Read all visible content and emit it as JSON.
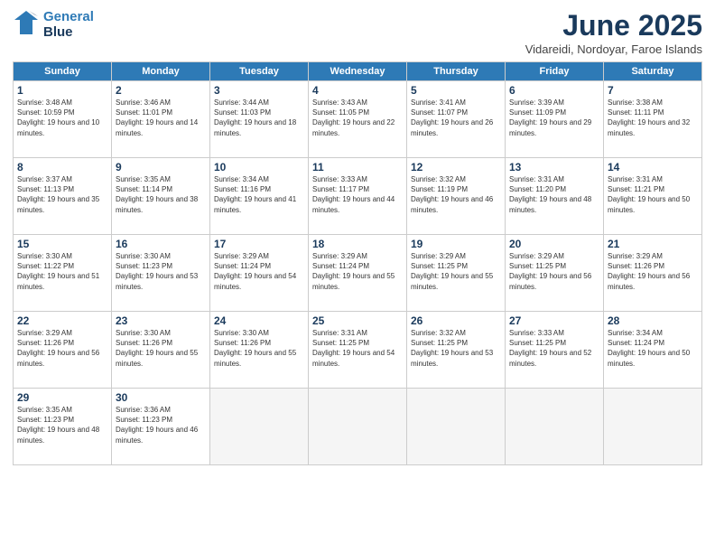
{
  "header": {
    "logo_line1": "General",
    "logo_line2": "Blue",
    "month_title": "June 2025",
    "subtitle": "Vidareidi, Nordoyar, Faroe Islands"
  },
  "weekdays": [
    "Sunday",
    "Monday",
    "Tuesday",
    "Wednesday",
    "Thursday",
    "Friday",
    "Saturday"
  ],
  "weeks": [
    [
      {
        "day": 1,
        "sunrise": "3:48 AM",
        "sunset": "10:59 PM",
        "daylight": "19 hours and 10 minutes."
      },
      {
        "day": 2,
        "sunrise": "3:46 AM",
        "sunset": "11:01 PM",
        "daylight": "19 hours and 14 minutes."
      },
      {
        "day": 3,
        "sunrise": "3:44 AM",
        "sunset": "11:03 PM",
        "daylight": "19 hours and 18 minutes."
      },
      {
        "day": 4,
        "sunrise": "3:43 AM",
        "sunset": "11:05 PM",
        "daylight": "19 hours and 22 minutes."
      },
      {
        "day": 5,
        "sunrise": "3:41 AM",
        "sunset": "11:07 PM",
        "daylight": "19 hours and 26 minutes."
      },
      {
        "day": 6,
        "sunrise": "3:39 AM",
        "sunset": "11:09 PM",
        "daylight": "19 hours and 29 minutes."
      },
      {
        "day": 7,
        "sunrise": "3:38 AM",
        "sunset": "11:11 PM",
        "daylight": "19 hours and 32 minutes."
      }
    ],
    [
      {
        "day": 8,
        "sunrise": "3:37 AM",
        "sunset": "11:13 PM",
        "daylight": "19 hours and 35 minutes."
      },
      {
        "day": 9,
        "sunrise": "3:35 AM",
        "sunset": "11:14 PM",
        "daylight": "19 hours and 38 minutes."
      },
      {
        "day": 10,
        "sunrise": "3:34 AM",
        "sunset": "11:16 PM",
        "daylight": "19 hours and 41 minutes."
      },
      {
        "day": 11,
        "sunrise": "3:33 AM",
        "sunset": "11:17 PM",
        "daylight": "19 hours and 44 minutes."
      },
      {
        "day": 12,
        "sunrise": "3:32 AM",
        "sunset": "11:19 PM",
        "daylight": "19 hours and 46 minutes."
      },
      {
        "day": 13,
        "sunrise": "3:31 AM",
        "sunset": "11:20 PM",
        "daylight": "19 hours and 48 minutes."
      },
      {
        "day": 14,
        "sunrise": "3:31 AM",
        "sunset": "11:21 PM",
        "daylight": "19 hours and 50 minutes."
      }
    ],
    [
      {
        "day": 15,
        "sunrise": "3:30 AM",
        "sunset": "11:22 PM",
        "daylight": "19 hours and 51 minutes."
      },
      {
        "day": 16,
        "sunrise": "3:30 AM",
        "sunset": "11:23 PM",
        "daylight": "19 hours and 53 minutes."
      },
      {
        "day": 17,
        "sunrise": "3:29 AM",
        "sunset": "11:24 PM",
        "daylight": "19 hours and 54 minutes."
      },
      {
        "day": 18,
        "sunrise": "3:29 AM",
        "sunset": "11:24 PM",
        "daylight": "19 hours and 55 minutes."
      },
      {
        "day": 19,
        "sunrise": "3:29 AM",
        "sunset": "11:25 PM",
        "daylight": "19 hours and 55 minutes."
      },
      {
        "day": 20,
        "sunrise": "3:29 AM",
        "sunset": "11:25 PM",
        "daylight": "19 hours and 56 minutes."
      },
      {
        "day": 21,
        "sunrise": "3:29 AM",
        "sunset": "11:26 PM",
        "daylight": "19 hours and 56 minutes."
      }
    ],
    [
      {
        "day": 22,
        "sunrise": "3:29 AM",
        "sunset": "11:26 PM",
        "daylight": "19 hours and 56 minutes."
      },
      {
        "day": 23,
        "sunrise": "3:30 AM",
        "sunset": "11:26 PM",
        "daylight": "19 hours and 55 minutes."
      },
      {
        "day": 24,
        "sunrise": "3:30 AM",
        "sunset": "11:26 PM",
        "daylight": "19 hours and 55 minutes."
      },
      {
        "day": 25,
        "sunrise": "3:31 AM",
        "sunset": "11:25 PM",
        "daylight": "19 hours and 54 minutes."
      },
      {
        "day": 26,
        "sunrise": "3:32 AM",
        "sunset": "11:25 PM",
        "daylight": "19 hours and 53 minutes."
      },
      {
        "day": 27,
        "sunrise": "3:33 AM",
        "sunset": "11:25 PM",
        "daylight": "19 hours and 52 minutes."
      },
      {
        "day": 28,
        "sunrise": "3:34 AM",
        "sunset": "11:24 PM",
        "daylight": "19 hours and 50 minutes."
      }
    ],
    [
      {
        "day": 29,
        "sunrise": "3:35 AM",
        "sunset": "11:23 PM",
        "daylight": "19 hours and 48 minutes."
      },
      {
        "day": 30,
        "sunrise": "3:36 AM",
        "sunset": "11:23 PM",
        "daylight": "19 hours and 46 minutes."
      },
      null,
      null,
      null,
      null,
      null
    ]
  ]
}
